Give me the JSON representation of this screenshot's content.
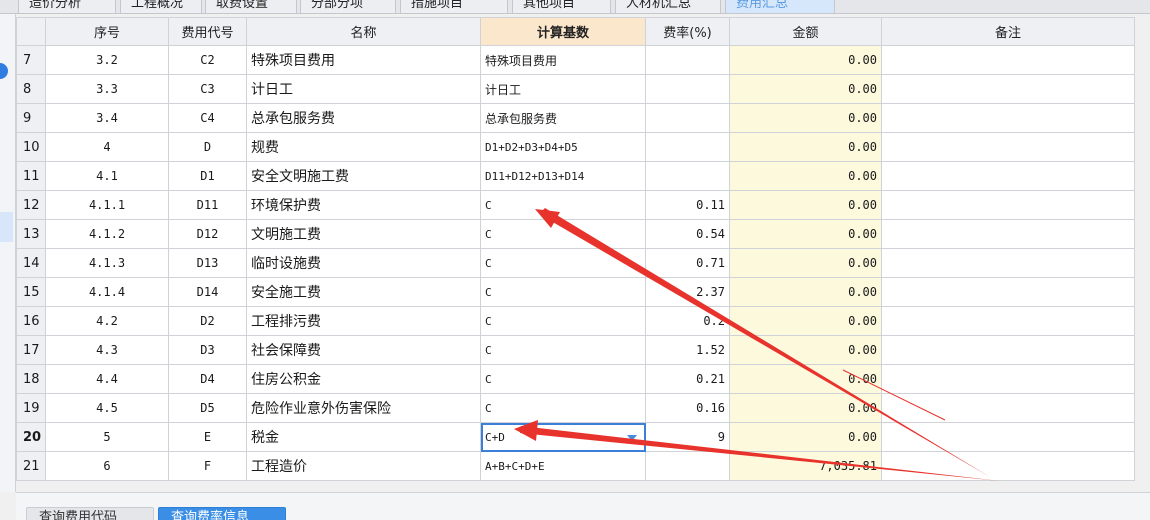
{
  "tabs": [
    "造价分析",
    "工程概况",
    "取费设置",
    "分部分项",
    "措施项目",
    "其他项目",
    "人材机汇总",
    "费用汇总"
  ],
  "active_tab": 7,
  "columns": [
    "",
    "序号",
    "费用代号",
    "名称",
    "计算基数",
    "费率(%)",
    "金额",
    "备注"
  ],
  "rows": [
    {
      "idx": "7",
      "seq": "3.2",
      "code": "C2",
      "name": "特殊项目费用",
      "base": "特殊项目费用",
      "rate": "",
      "amount": "0.00",
      "note": ""
    },
    {
      "idx": "8",
      "seq": "3.3",
      "code": "C3",
      "name": "计日工",
      "base": "计日工",
      "rate": "",
      "amount": "0.00",
      "note": ""
    },
    {
      "idx": "9",
      "seq": "3.4",
      "code": "C4",
      "name": "总承包服务费",
      "base": "总承包服务费",
      "rate": "",
      "amount": "0.00",
      "note": ""
    },
    {
      "idx": "10",
      "seq": "4",
      "code": "D",
      "name": "规费",
      "base": "D1+D2+D3+D4+D5",
      "rate": "",
      "amount": "0.00",
      "note": ""
    },
    {
      "idx": "11",
      "seq": "4.1",
      "code": "D1",
      "name": "安全文明施工费",
      "base": "D11+D12+D13+D14",
      "rate": "",
      "amount": "0.00",
      "note": ""
    },
    {
      "idx": "12",
      "seq": "4.1.1",
      "code": "D11",
      "name": "环境保护费",
      "base": "C",
      "rate": "0.11",
      "amount": "0.00",
      "note": ""
    },
    {
      "idx": "13",
      "seq": "4.1.2",
      "code": "D12",
      "name": "文明施工费",
      "base": "C",
      "rate": "0.54",
      "amount": "0.00",
      "note": ""
    },
    {
      "idx": "14",
      "seq": "4.1.3",
      "code": "D13",
      "name": "临时设施费",
      "base": "C",
      "rate": "0.71",
      "amount": "0.00",
      "note": ""
    },
    {
      "idx": "15",
      "seq": "4.1.4",
      "code": "D14",
      "name": "安全施工费",
      "base": "C",
      "rate": "2.37",
      "amount": "0.00",
      "note": ""
    },
    {
      "idx": "16",
      "seq": "4.2",
      "code": "D2",
      "name": "工程排污费",
      "base": "C",
      "rate": "0.2",
      "amount": "0.00",
      "note": ""
    },
    {
      "idx": "17",
      "seq": "4.3",
      "code": "D3",
      "name": "社会保障费",
      "base": "C",
      "rate": "1.52",
      "amount": "0.00",
      "note": ""
    },
    {
      "idx": "18",
      "seq": "4.4",
      "code": "D4",
      "name": "住房公积金",
      "base": "C",
      "rate": "0.21",
      "amount": "0.00",
      "note": ""
    },
    {
      "idx": "19",
      "seq": "4.5",
      "code": "D5",
      "name": "危险作业意外伤害保险",
      "base": "C",
      "rate": "0.16",
      "amount": "0.00",
      "note": ""
    },
    {
      "idx": "20",
      "seq": "5",
      "code": "E",
      "name": "税金",
      "base": "C+D",
      "rate": "9",
      "amount": "0.00",
      "note": ""
    },
    {
      "idx": "21",
      "seq": "6",
      "code": "F",
      "name": "工程造价",
      "base": "A+B+C+D+E",
      "rate": "",
      "amount": "7,035.81",
      "note": ""
    }
  ],
  "active_row": 13,
  "buttons": {
    "query_code": "查询费用代码",
    "query_rate": "查询费率信息"
  },
  "colors": {
    "accent": "#3a8ee6",
    "header_highlight": "#fbe7cc",
    "amount_bg": "#fdf9dc",
    "arrow": "#e8322c"
  }
}
